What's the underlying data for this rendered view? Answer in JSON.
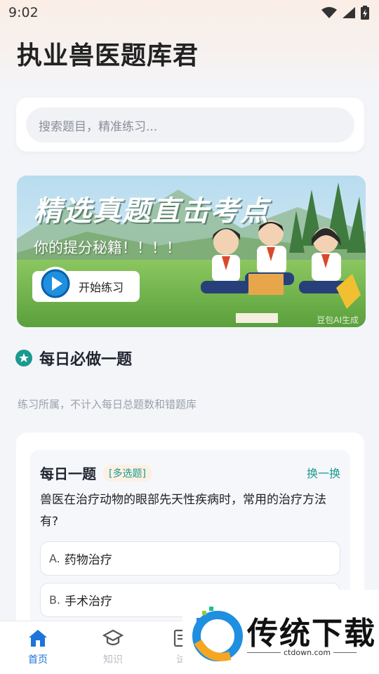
{
  "status": {
    "time": "9:02"
  },
  "app": {
    "title": "执业兽医题库君"
  },
  "search": {
    "placeholder": "搜索题目，精准练习..."
  },
  "banner": {
    "title": "精选真题直击考点",
    "subtitle": "你的提分秘籍！！！！",
    "button_label": "开始练习",
    "watermark": "豆包AI生成"
  },
  "daily": {
    "header": "每日必做一题",
    "note": "练习所属，不计入每日总题数和错题库",
    "card": {
      "label": "每日一题",
      "tag": "[多选题]",
      "switch_label": "换一换",
      "question": "兽医在治疗动物的眼部先天性疾病时，常用的治疗方法有?",
      "options": [
        {
          "letter": "A.",
          "text": "药物治疗"
        },
        {
          "letter": "B.",
          "text": "手术治疗"
        }
      ]
    }
  },
  "tabs": [
    {
      "label": "首页",
      "icon": "home-icon",
      "active": true
    },
    {
      "label": "知识",
      "icon": "graduation-cap-icon",
      "active": false
    },
    {
      "label": "试",
      "icon": "exam-icon",
      "active": false
    }
  ],
  "overlay": {
    "brand": "传统下载",
    "url": "ctdown.com"
  },
  "colors": {
    "accent": "#1b74d9",
    "teal": "#1a9a8f",
    "tag_bg": "#fdf0e3"
  }
}
